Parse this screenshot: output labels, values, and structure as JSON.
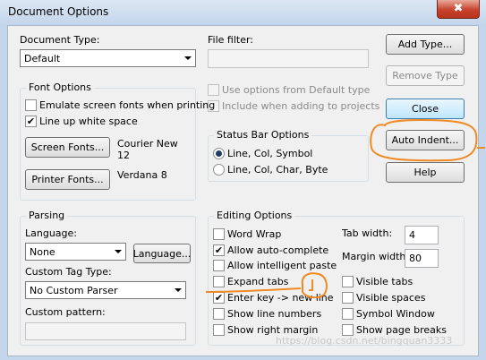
{
  "window": {
    "title": "Document Options",
    "close_glyph": "✖"
  },
  "document_type": {
    "label": "Document Type:",
    "value": "Default"
  },
  "file_filter": {
    "label": "File filter:",
    "value": ""
  },
  "options_default": {
    "use_default": "Use options from Default type",
    "include_default": "Include when adding to projects"
  },
  "buttons": {
    "add_type": "Add Type...",
    "remove_type": "Remove Type",
    "close": "Close",
    "auto_indent": "Auto Indent...",
    "help": "Help",
    "screen_fonts": "Screen Fonts...",
    "printer_fonts": "Printer Fonts...",
    "language": "Language..."
  },
  "font_options": {
    "title": "Font Options",
    "emulate": {
      "label": "Emulate screen fonts when printing",
      "checked": false
    },
    "line_up": {
      "label": "Line up white space",
      "checked": true
    },
    "screen_font_name": "Courier New",
    "screen_font_size": "12",
    "printer_font": "Verdana 8"
  },
  "status_bar": {
    "title": "Status Bar Options",
    "options": [
      "Line, Col, Symbol",
      "Line, Col, Char, Byte"
    ],
    "selected": "Line, Col, Symbol"
  },
  "parsing": {
    "title": "Parsing",
    "language_label": "Language:",
    "language_value": "None",
    "custom_tag_label": "Custom Tag Type:",
    "custom_tag_value": "No Custom Parser",
    "custom_pattern_label": "Custom pattern:",
    "custom_pattern_value": ""
  },
  "editing": {
    "title": "Editing Options",
    "word_wrap": {
      "label": "Word Wrap",
      "checked": false
    },
    "auto_complete": {
      "label": "Allow auto-complete",
      "checked": true
    },
    "intelligent_paste": {
      "label": "Allow intelligent paste",
      "checked": false
    },
    "expand_tabs": {
      "label": "Expand tabs",
      "checked": false
    },
    "enter_key": {
      "label": "Enter key -> new line",
      "checked": true
    },
    "show_line_numbers": {
      "label": "Show line numbers",
      "checked": false
    },
    "show_right_margin": {
      "label": "Show right margin",
      "checked": false
    },
    "tab_width_label": "Tab width:",
    "tab_width": "4",
    "margin_width_label": "Margin width:",
    "margin_width": "80",
    "visible_tabs": {
      "label": "Visible tabs",
      "checked": false
    },
    "visible_spaces": {
      "label": "Visible spaces",
      "checked": false
    },
    "symbol_window": {
      "label": "Symbol Window",
      "checked": false
    },
    "show_page_breaks": {
      "label": "Show page breaks",
      "checked": false
    }
  },
  "watermark": "https://blog.csdn.net/bingquan3333",
  "annotation_color": "#f08a24",
  "check_glyph": "✔"
}
